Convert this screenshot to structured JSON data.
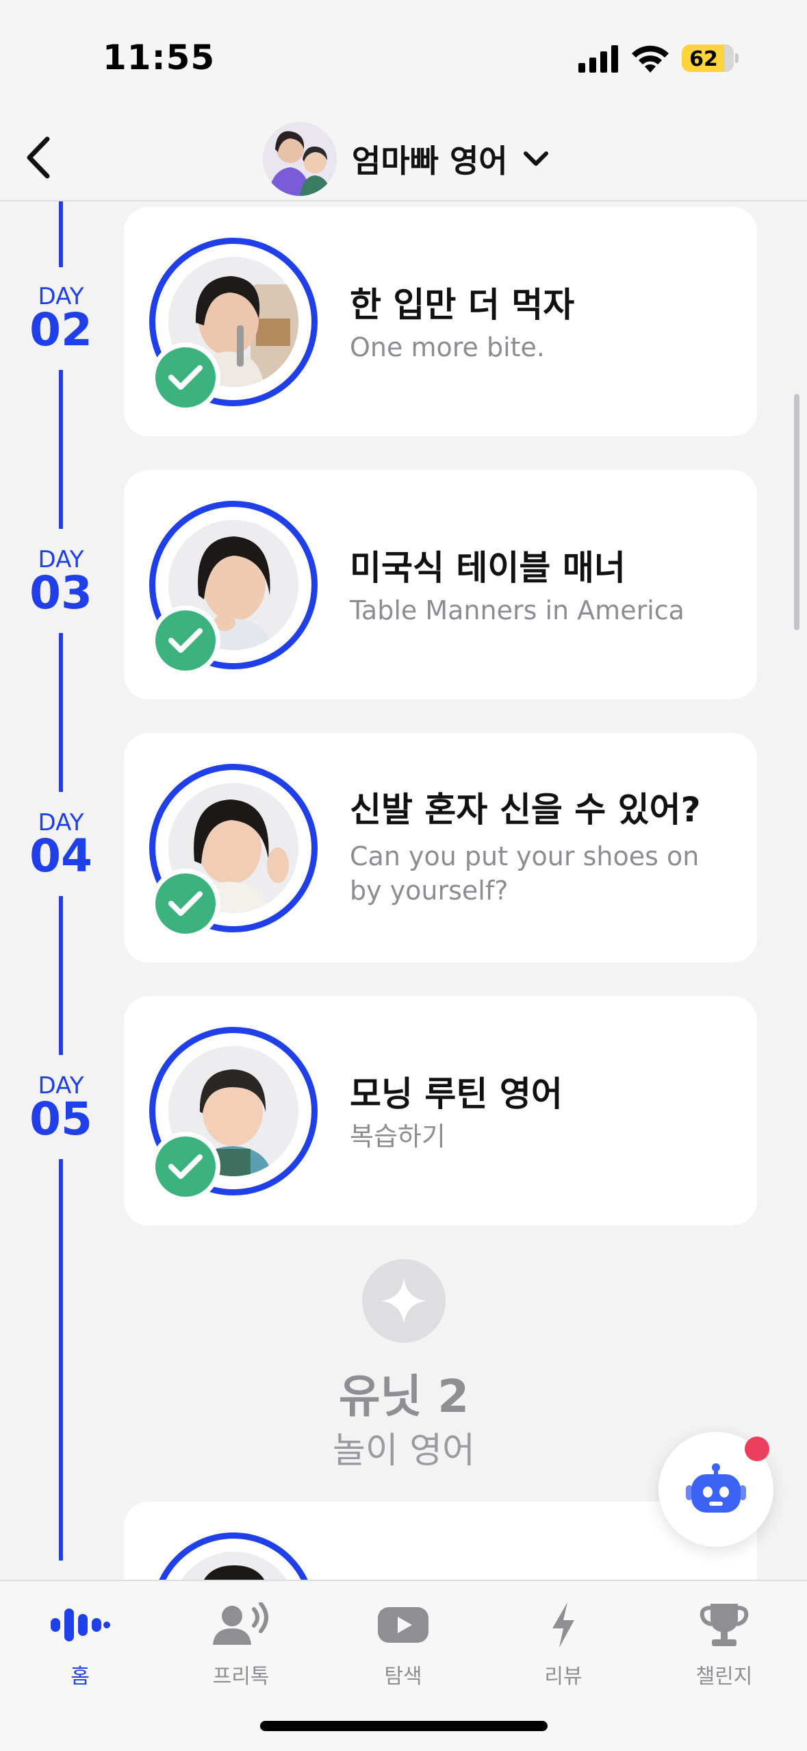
{
  "status_bar": {
    "time": "11:55",
    "battery": "62"
  },
  "header": {
    "course_title": "엄마빠 영어"
  },
  "lessons": [
    {
      "day_word": "DAY",
      "day_num": "02",
      "title": "한 입만 더 먹자",
      "subtitle": "One more bite.",
      "completed": true
    },
    {
      "day_word": "DAY",
      "day_num": "03",
      "title": "미국식 테이블 매너",
      "subtitle": "Table Manners in America",
      "completed": true
    },
    {
      "day_word": "DAY",
      "day_num": "04",
      "title": "신발 혼자 신을 수 있어?",
      "subtitle": "Can you put your shoes on by yourself?",
      "completed": true
    },
    {
      "day_word": "DAY",
      "day_num": "05",
      "title": "모닝 루틴 영어",
      "subtitle": "복습하기",
      "completed": true
    }
  ],
  "unit": {
    "title": "유닛 2",
    "subtitle": "놀이 영어"
  },
  "tabs": [
    {
      "label": "홈",
      "icon": "home-wave-icon",
      "active": true
    },
    {
      "label": "프리톡",
      "icon": "free-talk-icon",
      "active": false
    },
    {
      "label": "탐색",
      "icon": "video-play-icon",
      "active": false
    },
    {
      "label": "리뷰",
      "icon": "lightning-icon",
      "active": false
    },
    {
      "label": "챌린지",
      "icon": "trophy-icon",
      "active": false
    }
  ],
  "colors": {
    "accent": "#1f3fe8",
    "check": "#3cb37e",
    "notification": "#ee3e5e",
    "inactive": "#8e8e93"
  }
}
